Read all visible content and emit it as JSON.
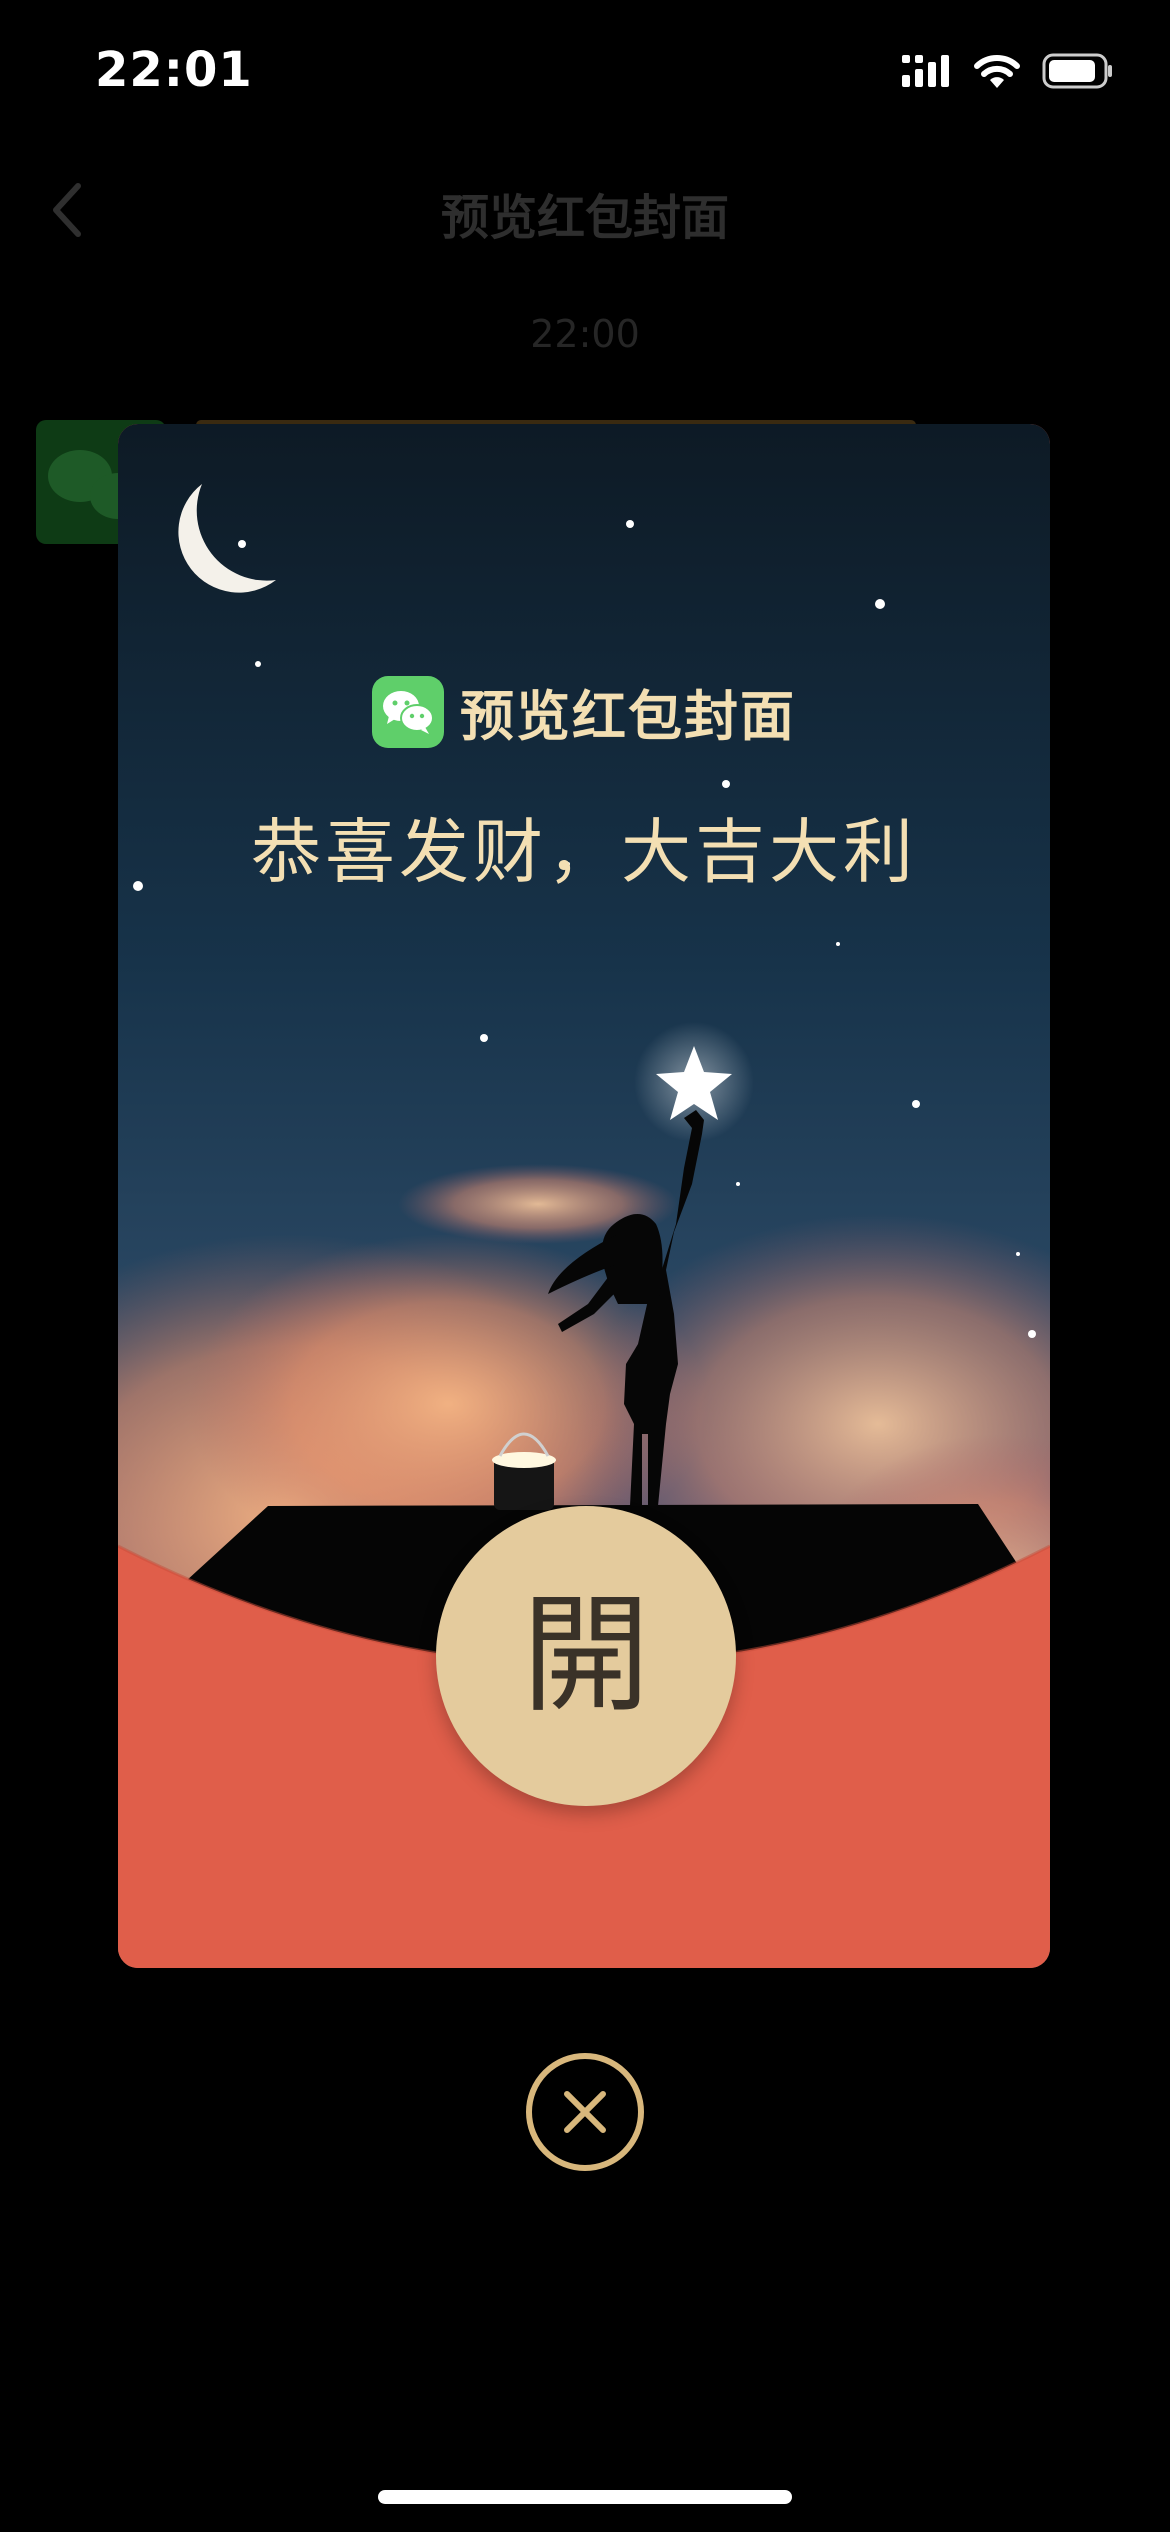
{
  "status_bar": {
    "time": "22:01",
    "icons": [
      "cellular-signal-icon",
      "wifi-icon",
      "battery-icon"
    ]
  },
  "background_chat": {
    "nav_title": "预览红包封面",
    "chat_time": "22:00",
    "back_icon": "chevron-left-icon"
  },
  "envelope": {
    "brand_icon": "wechat-icon",
    "title": "预览红包封面",
    "greeting": "恭喜发财，大吉大利",
    "open_label": "開",
    "illustration": "night-sky-girl-reaching-star",
    "colors": {
      "envelope_red": "#e05e4a",
      "gold_text": "#f3dfb3",
      "open_button": "#e4cb9d",
      "close_ring": "#d8b77c"
    }
  },
  "close_icon": "close-circle-icon"
}
